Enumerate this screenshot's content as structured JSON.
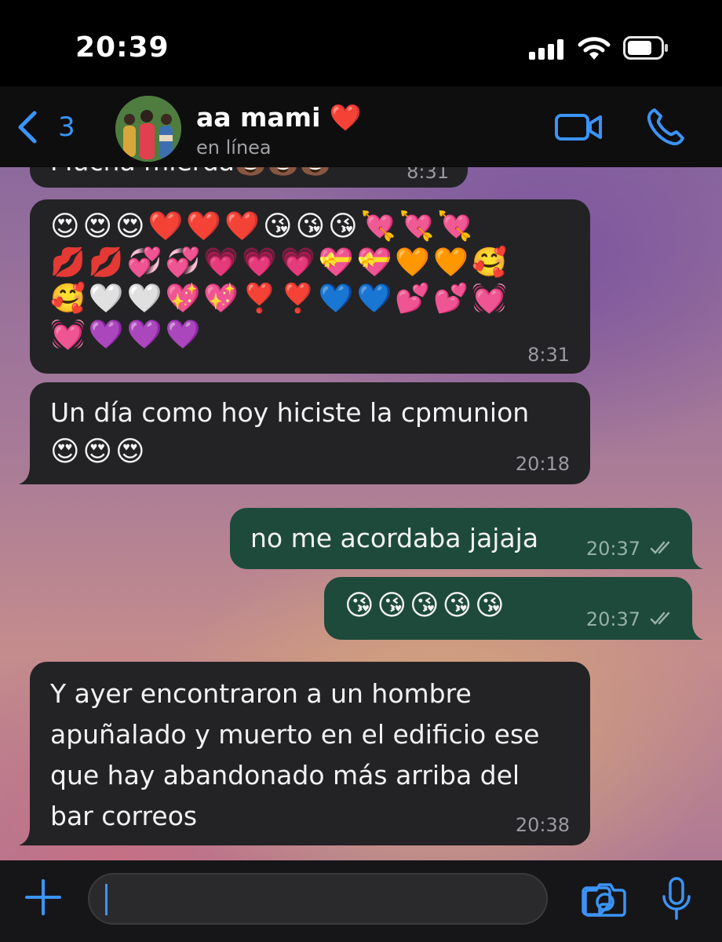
{
  "status_bar": {
    "time": "20:39"
  },
  "header": {
    "back_count": "3",
    "contact_name": "aa mami",
    "contact_heart": "❤️",
    "contact_status": "en línea"
  },
  "messages": [
    {
      "direction": "incoming",
      "text": "Mucha mierda💩💩💩",
      "time": "8:31",
      "partial": true
    },
    {
      "direction": "incoming",
      "lines": [
        "😍😍😍❤️❤️❤️😘😘😘💘💘💘",
        "💋💋💞💞💗💗💗💝💝🧡🧡🥰",
        "🥰🤍🤍💖💖❣️❣️💙💙💕💕💓",
        "💓💜💜💜"
      ],
      "time": "8:31"
    },
    {
      "direction": "incoming",
      "text": "Un día como hoy hiciste la cpmunion",
      "emoji": "😍😍😍",
      "time": "20:18"
    },
    {
      "direction": "outgoing",
      "text": "no me acordaba jajaja",
      "time": "20:37",
      "read": true
    },
    {
      "direction": "outgoing",
      "emoji": "😘😘😘😘😘",
      "time": "20:37",
      "read": true
    },
    {
      "direction": "incoming",
      "lines": [
        "Y ayer encontraron a un hombre",
        "apuñalado y muerto en el edificio ese",
        "que hay abandonado más arriba del",
        "bar correos"
      ],
      "time": "20:38"
    }
  ],
  "composer": {
    "placeholder": ""
  },
  "colors": {
    "accent": "#3b94f7",
    "incoming_bubble": "#232325",
    "outgoing_bubble": "#1d4a3b",
    "header_bg": "#0e0e0f"
  },
  "icons": {
    "back": "chevron-left-icon",
    "video": "video-camera-icon",
    "call": "phone-icon",
    "attach": "plus-icon",
    "sticker": "sticker-icon",
    "camera": "camera-icon",
    "mic": "microphone-icon"
  }
}
